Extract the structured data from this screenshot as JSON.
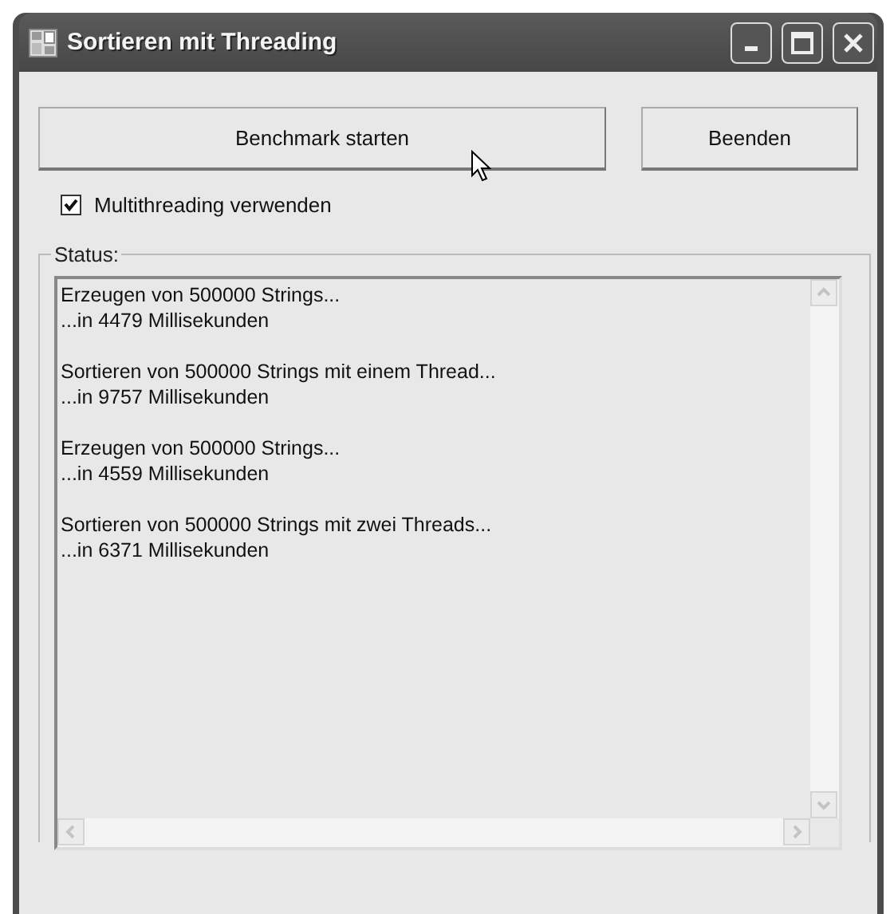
{
  "window": {
    "title": "Sortieren mit Threading"
  },
  "buttons": [
    {
      "label": "Benchmark starten",
      "kind": "wide"
    },
    {
      "label": "Beenden",
      "kind": "normal"
    }
  ],
  "checkbox": {
    "label": "Multithreading verwenden",
    "checked": true
  },
  "status": {
    "label": "Status:",
    "disabled": true,
    "entries": [
      {
        "action": "Erzeugen von 500000 Strings...",
        "result": "...in 4479 Millisekunden"
      },
      {
        "action": "Sortieren von 500000 Strings mit einem Thread...",
        "result": "...in 9757 Millisekunden"
      },
      {
        "action": "Erzeugen von 500000 Strings...",
        "result": "...in 4559 Millisekunden"
      },
      {
        "action": "Sortieren von 500000 Strings mit zwei Threads...",
        "result": "...in 6371 Millisekunden"
      }
    ]
  }
}
